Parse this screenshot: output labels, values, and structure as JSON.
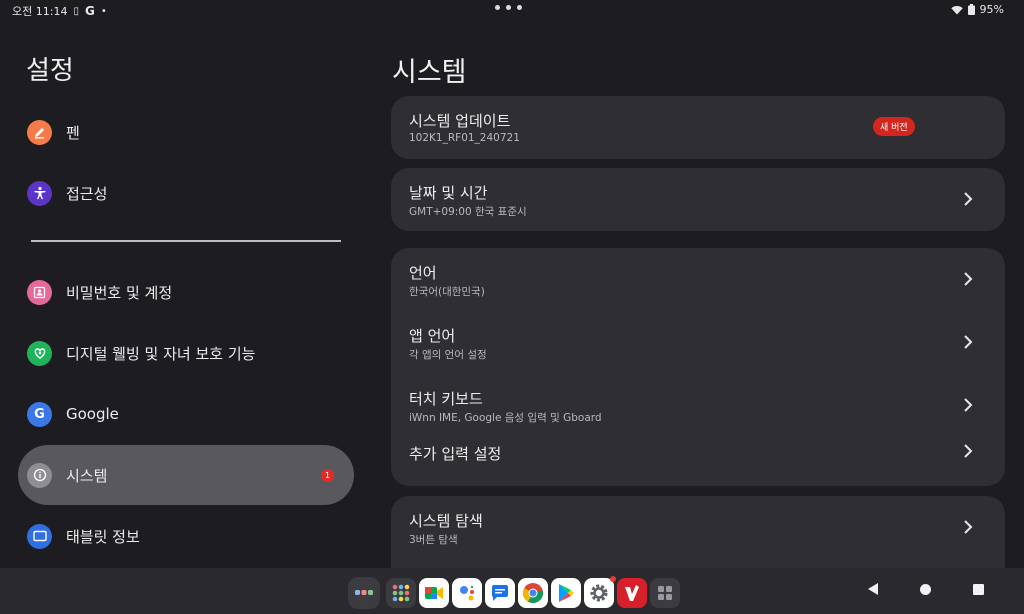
{
  "status_bar": {
    "time": "오전 11:14",
    "google_icon": "G",
    "battery": "95%"
  },
  "left": {
    "title": "설정",
    "items": [
      {
        "label": "펜",
        "icon": "pen-icon",
        "color": "#f47c4a"
      },
      {
        "label": "접근성",
        "icon": "accessibility-icon",
        "color": "#5a35c8"
      },
      {
        "label": "비밀번호 및 계정",
        "icon": "account-icon",
        "color": "#e46a9a"
      },
      {
        "label": "디지털 웰빙 및 자녀 보호 기능",
        "icon": "wellbeing-icon",
        "color": "#1fb45a"
      },
      {
        "label": "Google",
        "icon": "google-icon",
        "color": "#3a78e6"
      },
      {
        "label": "시스템",
        "icon": "info-icon",
        "color": "#8e8e93",
        "badge": "1"
      },
      {
        "label": "태블릿 정보",
        "icon": "tablet-icon",
        "color": "#2f6fe0"
      }
    ]
  },
  "right": {
    "title": "시스템",
    "cards": [
      {
        "rows": [
          {
            "title": "시스템 업데이트",
            "subtitle": "102K1_RF01_240721",
            "badge": "새 버전"
          }
        ]
      },
      {
        "rows": [
          {
            "title": "날짜 및 시간",
            "subtitle": "GMT+09:00 한국 표준시"
          }
        ]
      },
      {
        "rows": [
          {
            "title": "언어",
            "subtitle": "한국어(대한민국)"
          },
          {
            "title": "앱 언어",
            "subtitle": "각 앱의 언어 설정"
          },
          {
            "title": "터치 키보드",
            "subtitle": "iWnn IME, Google 음성 입력 및 Gboard"
          },
          {
            "title": "추가 입력 설정",
            "subtitle": ""
          }
        ]
      },
      {
        "rows": [
          {
            "title": "시스템 탐색",
            "subtitle": "3버튼 탐색"
          }
        ]
      }
    ]
  },
  "taskbar": {
    "apps": [
      "all-apps-icon",
      "app-grid-icon",
      "meet-icon",
      "assistant-icon",
      "messages-icon",
      "chrome-icon",
      "play-store-icon",
      "settings-icon",
      "app-v-icon",
      "app-drawer-icon"
    ]
  }
}
